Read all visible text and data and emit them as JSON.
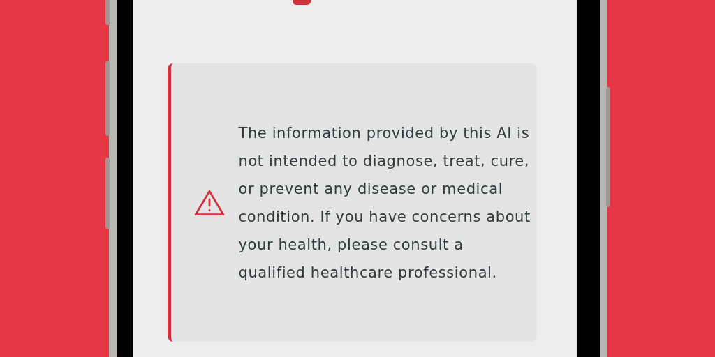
{
  "disclaimer": {
    "kind": "warning",
    "text": "The information provided by this AI is not intended to diagnose, treat, cure, or prevent any disease or medical condition. If you have concerns about your health, please consult a qualified healthcare professional."
  }
}
